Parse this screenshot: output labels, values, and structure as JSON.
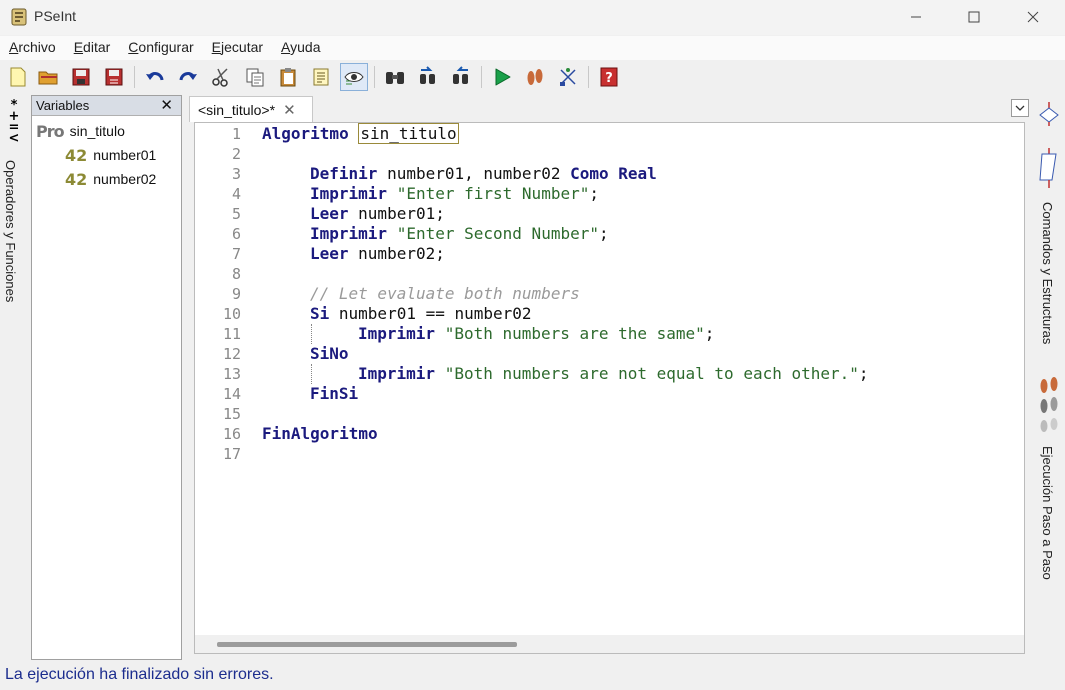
{
  "window": {
    "title": "PSeInt"
  },
  "menu": [
    {
      "label": "Archivo",
      "accel": "A",
      "rest": "rchivo"
    },
    {
      "label": "Editar",
      "accel": "E",
      "rest": "ditar"
    },
    {
      "label": "Configurar",
      "accel": "C",
      "rest": "onfigurar"
    },
    {
      "label": "Ejecutar",
      "accel": "E",
      "rest": "jecutar"
    },
    {
      "label": "Ayuda",
      "accel": "A",
      "rest": "yuda"
    }
  ],
  "toolbar": {
    "icons": [
      "new-file-icon",
      "open-folder-icon",
      "save-icon",
      "save-as-icon",
      "undo-icon",
      "redo-icon",
      "cut-icon",
      "copy-icon",
      "paste-icon",
      "edit-text-icon",
      "inspect-eye-icon",
      "find-binoculars-icon",
      "find-previous-icon",
      "find-next-icon",
      "run-icon",
      "step-by-step-icon",
      "flowchart-icon",
      "help-icon"
    ]
  },
  "left_tab": {
    "symbols": "*\n+\n=\n<",
    "label": "Operadores y Funciones"
  },
  "variables_panel": {
    "title": "Variables",
    "close": "✕",
    "algorithm": {
      "badge": "Pro",
      "name": "sin_titulo"
    },
    "vars": [
      {
        "badge": "42",
        "name": "number01"
      },
      {
        "badge": "42",
        "name": "number02"
      }
    ]
  },
  "editor": {
    "tab_label": "<sin_titulo>*",
    "tab_close": "✕",
    "line_numbers": [
      "1",
      "2",
      "3",
      "4",
      "5",
      "6",
      "7",
      "8",
      "9",
      "10",
      "11",
      "12",
      "13",
      "14",
      "15",
      "16",
      "17"
    ],
    "lines": {
      "l1_kw": "Algoritmo",
      "l1_name": "sin_titulo",
      "l3_kw1": "Definir",
      "l3_vars": " number01, number02 ",
      "l3_kw2": "Como Real",
      "l4_kw": "Imprimir",
      "l4_str": " \"Enter first Number\"",
      "l4_end": ";",
      "l5_kw": "Leer",
      "l5_rest": " number01;",
      "l6_kw": "Imprimir",
      "l6_str": " \"Enter Second Number\"",
      "l6_end": ";",
      "l7_kw": "Leer",
      "l7_rest": " number02;",
      "l9_cmt": "// Let evaluate both numbers",
      "l10_kw": "Si",
      "l10_rest": " number01 == number02",
      "l11_kw": "Imprimir",
      "l11_str": " \"Both numbers are the same\"",
      "l11_end": ";",
      "l12_kw": "SiNo",
      "l13_kw": "Imprimir",
      "l13_str": " \"Both numbers are not equal to each other.\"",
      "l13_end": ";",
      "l14_kw": "FinSi",
      "l16_kw": "FinAlgoritmo"
    }
  },
  "right_bar": {
    "label_commands": "Comandos y Estructuras",
    "label_steps": "Ejecución Paso a Paso"
  },
  "status": {
    "text": "La ejecución ha finalizado sin errores."
  },
  "colors": {
    "keyword": "#1b1a7e",
    "string": "#2d6a2d",
    "comment": "#9a9a9a",
    "status": "#1c2d8e"
  }
}
